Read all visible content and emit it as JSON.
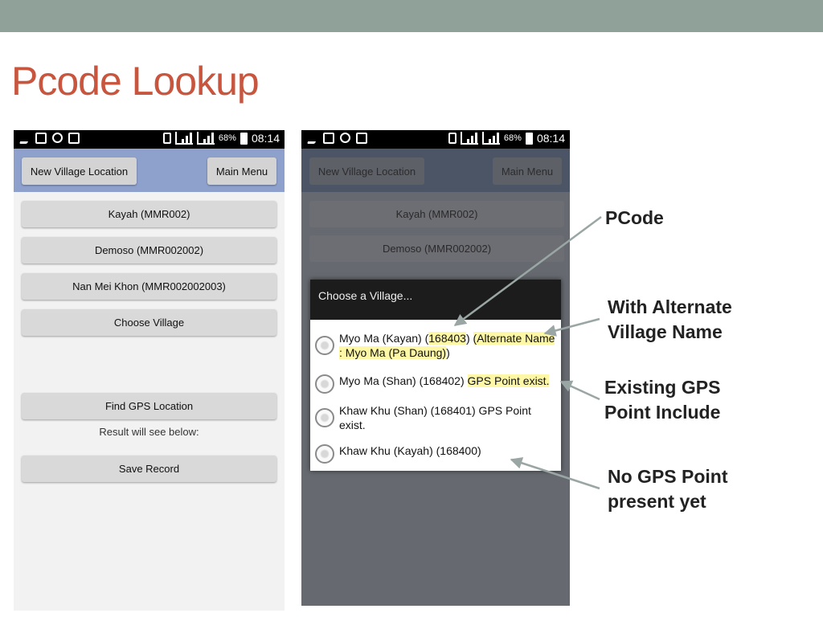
{
  "slide": {
    "title": "Pcode Lookup",
    "accent_color": "#c8553d",
    "band_color": "#8fa198"
  },
  "statusbar": {
    "battery": "68%",
    "time": "08:14",
    "icons": [
      "airplane-icon",
      "image-icon",
      "people-icon",
      "message-icon",
      "vibrate-icon",
      "signal-icon",
      "signal-icon",
      "battery-icon"
    ]
  },
  "app": {
    "new_location_label": "New Village Location",
    "main_menu_label": "Main Menu",
    "state_button": "Kayah (MMR002)",
    "township_button": "Demoso (MMR002002)",
    "tract_button": "Nan Mei Khon (MMR002002003)",
    "choose_village_button": "Choose Village",
    "find_gps_button": "Find GPS Location",
    "result_text": "Result will see below:",
    "save_button": "Save Record"
  },
  "dialog": {
    "title": "Choose a Village...",
    "options": [
      {
        "name_before": "Myo Ma (Kayan) (",
        "pcode": "168403",
        "name_after": ") ",
        "alt_name": "(Alternate Name : Myo Ma (Pa Daung)",
        "closing": ")"
      },
      {
        "name": "Myo Ma (Shan) (168402) ",
        "gps": "GPS Point exist."
      },
      {
        "name": "Khaw Khu (Shan) (168401) GPS Point exist."
      },
      {
        "name": "Khaw Khu (Kayah) (168400)"
      }
    ]
  },
  "annotations": {
    "pcode": "PCode",
    "alternate_line1": "With Alternate",
    "alternate_line2": "Village Name",
    "gps_line1": "Existing GPS",
    "gps_line2": "Point Include",
    "nogps_line1": "No GPS Point",
    "nogps_line2": "present yet"
  }
}
